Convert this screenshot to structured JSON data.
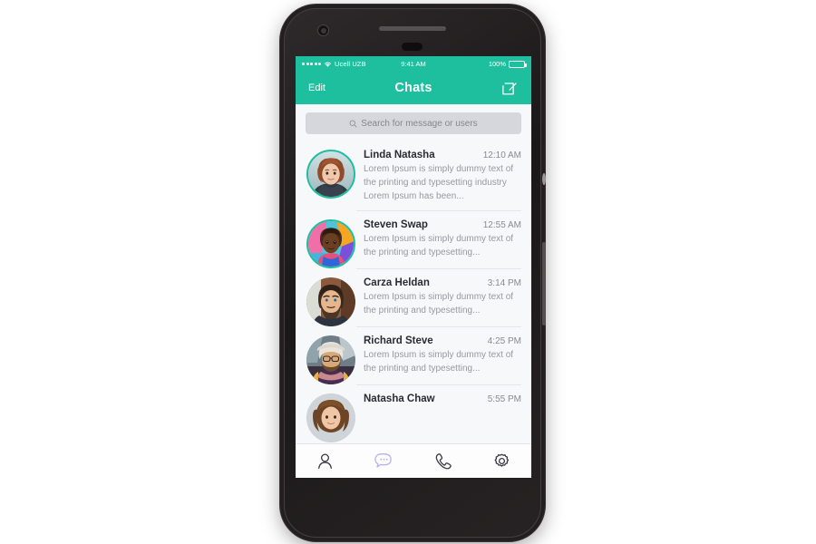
{
  "device": {
    "frame_color": "#231f20",
    "screen_bg": "#f7f8fa"
  },
  "status_bar": {
    "signal_dots": 5,
    "wifi_icon": "wifi-icon",
    "carrier": "Ucell UZB",
    "time": "9:41 AM",
    "battery_percent": "100%",
    "battery_icon": "battery-full-icon",
    "bg_color": "#1dbf9f",
    "text_color": "#ffffff"
  },
  "nav_bar": {
    "edit_label": "Edit",
    "title": "Chats",
    "compose_icon": "compose-pencil-icon",
    "bg_color": "#1dbf9f"
  },
  "search": {
    "icon": "search-icon",
    "placeholder": "Search for message or users",
    "value": "",
    "bg_color": "#d6d7dc"
  },
  "chats": [
    {
      "name": "Linda Natasha",
      "time": "12:10 AM",
      "snippet": "Lorem Ipsum is simply dummy text of the printing and typesetting industry Lorem Ipsum has been...",
      "avatar": "avatar-linda-natasha",
      "ring": true,
      "ring_color": "#1dbf9f"
    },
    {
      "name": "Steven Swap",
      "time": "12:55 AM",
      "snippet": "Lorem Ipsum is simply dummy text of the printing and typesetting...",
      "avatar": "avatar-steven-swap",
      "ring": true,
      "ring_color": "#1dbf9f"
    },
    {
      "name": "Carza Heldan",
      "time": "3:14 PM",
      "snippet": "Lorem Ipsum is simply dummy text of the printing and typesetting...",
      "avatar": "avatar-carza-heldan",
      "ring": false,
      "ring_color": ""
    },
    {
      "name": "Richard Steve",
      "time": "4:25 PM",
      "snippet": "Lorem Ipsum is simply dummy text of the printing and typesetting...",
      "avatar": "avatar-richard-steve",
      "ring": false,
      "ring_color": ""
    },
    {
      "name": "Natasha Chaw",
      "time": "5:55 PM",
      "snippet": "",
      "avatar": "avatar-natasha-chaw",
      "ring": false,
      "ring_color": ""
    }
  ],
  "tab_bar": {
    "items": [
      {
        "icon": "contacts-person-icon",
        "active": false,
        "color": "#3a3a44"
      },
      {
        "icon": "chat-bubble-icon",
        "active": true,
        "color": "#b9b5e0"
      },
      {
        "icon": "phone-handset-icon",
        "active": false,
        "color": "#3a3a44"
      },
      {
        "icon": "settings-gear-icon",
        "active": false,
        "color": "#3a3a44"
      }
    ],
    "bg_color": "#fdfdfe"
  }
}
